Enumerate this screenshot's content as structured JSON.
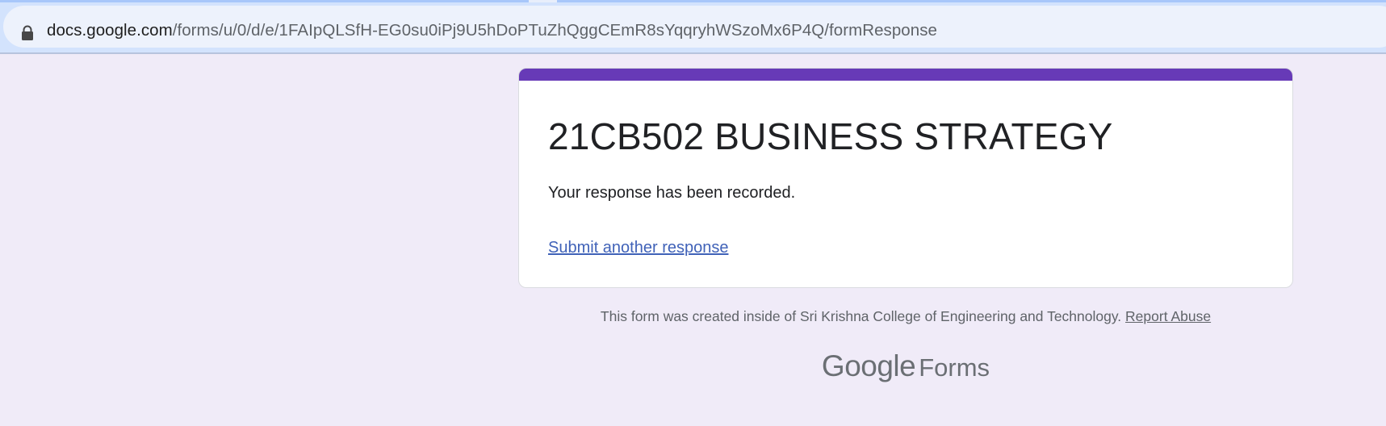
{
  "browser": {
    "url_host": "docs.google.com",
    "url_path": "/forms/u/0/d/e/1FAIpQLSfH-EG0su0iPj9U5hDoPTuZhQggCEmR8sYqqryhWSzoMx6P4Q/formResponse",
    "lock_icon": "lock-icon"
  },
  "form": {
    "title": "21CB502 BUSINESS STRATEGY",
    "confirmation": "Your response has been recorded.",
    "submit_another": "Submit another response",
    "accent_color": "#673ab7"
  },
  "footer": {
    "created_inside": "This form was created inside of Sri Krishna College of Engineering and Technology.",
    "report_abuse": "Report Abuse",
    "logo_google": "Google",
    "logo_forms": "Forms"
  },
  "colors": {
    "page_background": "#f0ebf8",
    "browser_chrome": "#d3e3fd",
    "link": "#4062b8"
  }
}
